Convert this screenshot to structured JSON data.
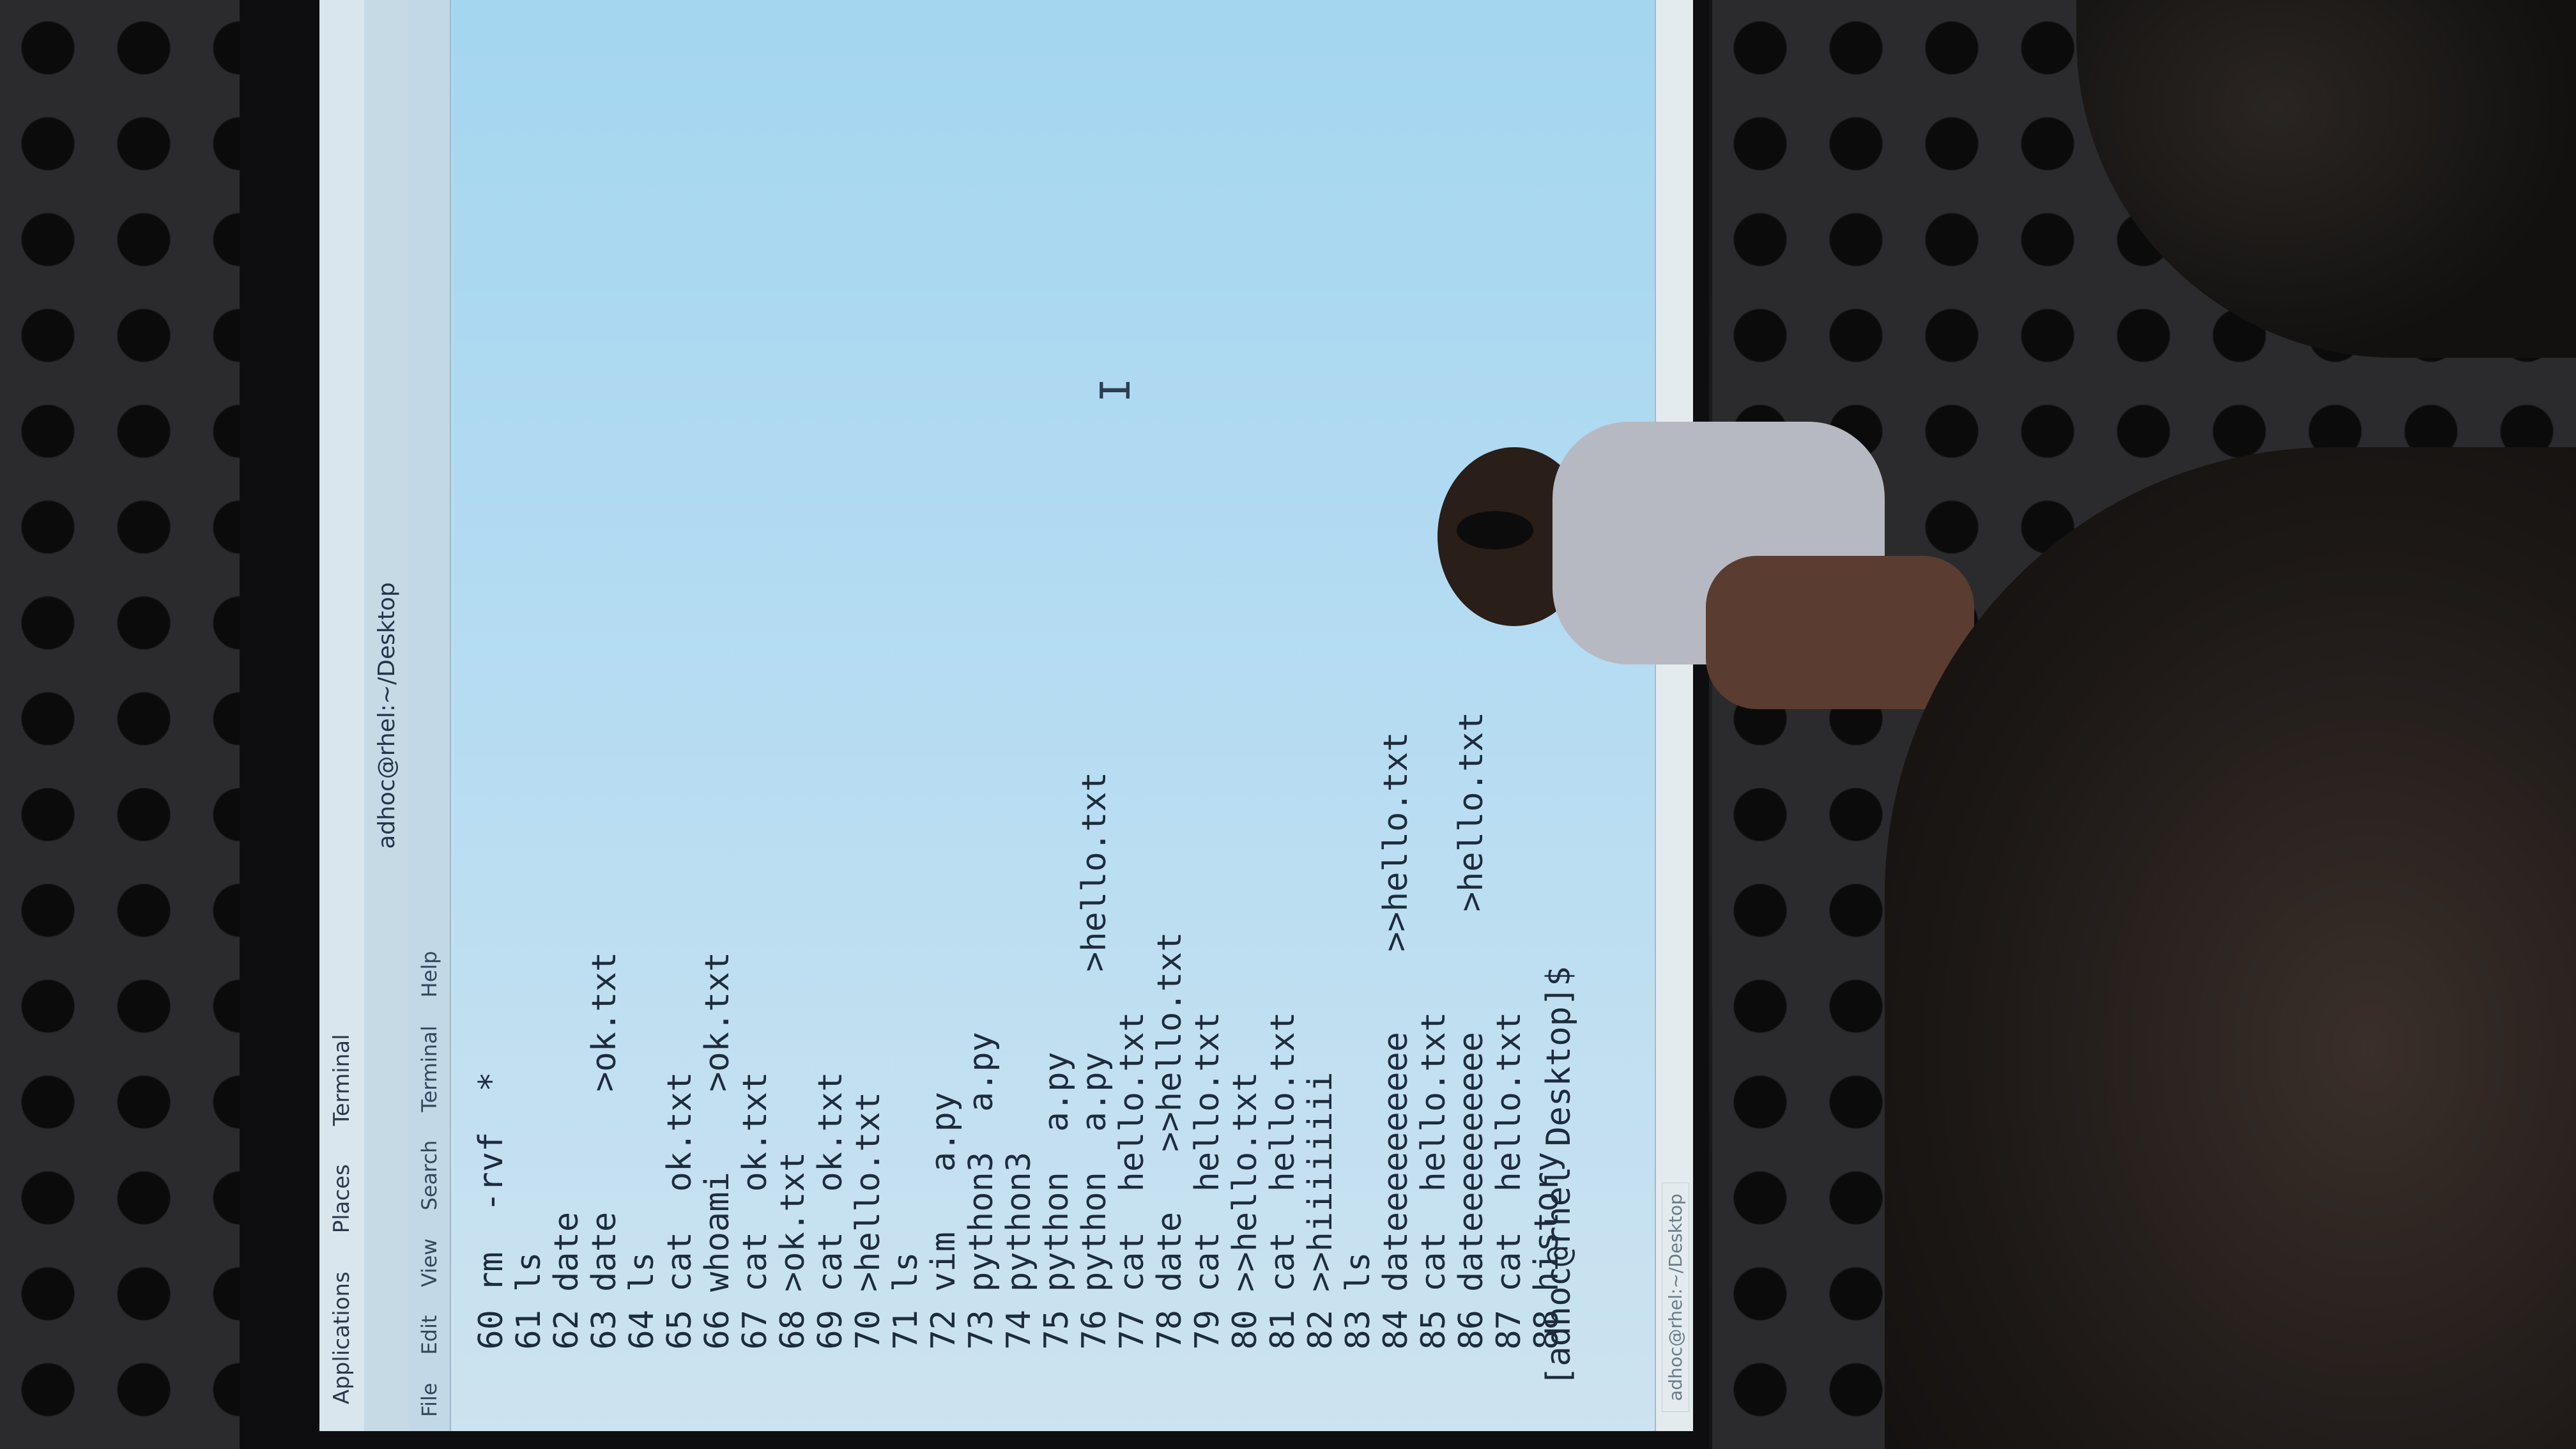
{
  "top_panel": {
    "applications": "Applications",
    "places": "Places",
    "terminal": "Terminal"
  },
  "window": {
    "title": "adhoc@rhel:~/Desktop"
  },
  "menubar": [
    "File",
    "Edit",
    "View",
    "Search",
    "Terminal",
    "Help"
  ],
  "history": [
    {
      "n": "60",
      "cmd": "rm  -rvf  *"
    },
    {
      "n": "61",
      "cmd": "ls"
    },
    {
      "n": "62",
      "cmd": "date"
    },
    {
      "n": "63",
      "cmd": "date      >ok.txt"
    },
    {
      "n": "64",
      "cmd": "ls"
    },
    {
      "n": "65",
      "cmd": "cat  ok.txt"
    },
    {
      "n": "66",
      "cmd": "whoami    >ok.txt"
    },
    {
      "n": "67",
      "cmd": "cat  ok.txt"
    },
    {
      "n": "68",
      "cmd": ">ok.txt"
    },
    {
      "n": "69",
      "cmd": "cat  ok.txt"
    },
    {
      "n": "70",
      "cmd": ">hello.txt"
    },
    {
      "n": "71",
      "cmd": "ls"
    },
    {
      "n": "72",
      "cmd": "vim   a.py"
    },
    {
      "n": "73",
      "cmd": "python3  a.py"
    },
    {
      "n": "74",
      "cmd": "python3"
    },
    {
      "n": "75",
      "cmd": "python  a.py"
    },
    {
      "n": "76",
      "cmd": "python  a.py    >hello.txt"
    },
    {
      "n": "77",
      "cmd": "cat  hello.txt"
    },
    {
      "n": "78",
      "cmd": "date   >>hello.txt"
    },
    {
      "n": "79",
      "cmd": "cat  hello.txt"
    },
    {
      "n": "80",
      "cmd": ">>hello.txt"
    },
    {
      "n": "81",
      "cmd": "cat  hello.txt"
    },
    {
      "n": "82",
      "cmd": ">>hiiiiiiii"
    },
    {
      "n": "83",
      "cmd": "ls"
    },
    {
      "n": "84",
      "cmd": "dateeeeeeeeee    >>hello.txt"
    },
    {
      "n": "85",
      "cmd": "cat  hello.txt"
    },
    {
      "n": "86",
      "cmd": "dateeeeeeeeee      >hello.txt"
    },
    {
      "n": "87",
      "cmd": "cat  hello.txt"
    },
    {
      "n": "88",
      "cmd": "history"
    }
  ],
  "prompt": "[adhoc@rhel Desktop]$",
  "cursor_glyph": "I",
  "taskbar": {
    "item": "adhoc@rhel:~/Desktop"
  },
  "colors": {
    "terminal_bg": "#b6dcf2",
    "terminal_fg": "#1d2c3d",
    "panel_bg": "#d9e6ee"
  }
}
